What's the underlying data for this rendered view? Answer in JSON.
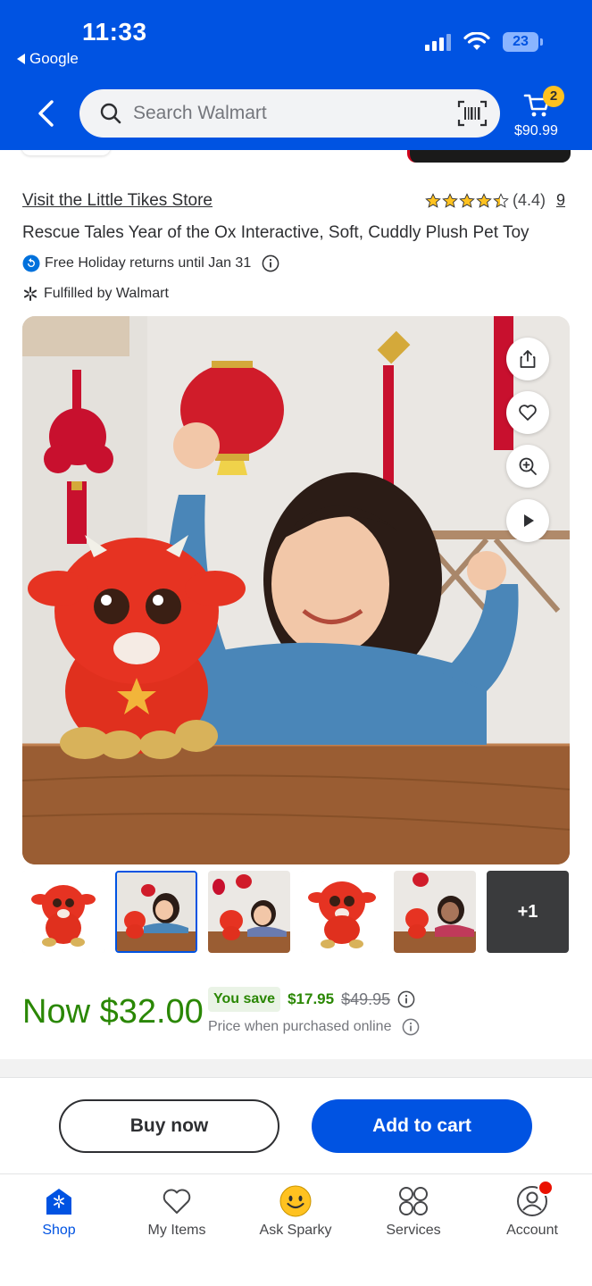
{
  "status_bar": {
    "time": "11:33",
    "back_app": "Google",
    "battery": "23"
  },
  "header": {
    "search": {
      "placeholder": "Search Walmart"
    },
    "cart": {
      "badge": "2",
      "total": "$90.99"
    }
  },
  "product": {
    "store_link": "Visit the Little Tikes Store",
    "rating": {
      "stars": 4.4,
      "value_text": "(4.4)",
      "count": "9"
    },
    "title": "Rescue Tales Year of the Ox Interactive, Soft, Cuddly Plush Pet Toy",
    "returns": "Free Holiday returns until Jan 31",
    "fulfilled": "Fulfilled by Walmart",
    "image_actions": [
      "share-icon",
      "heart-icon",
      "zoom-icon",
      "play-icon"
    ],
    "thumbnails": {
      "count": 6,
      "selected_index": 1,
      "more_label": "+1"
    }
  },
  "price": {
    "now": "Now $32.00",
    "you_save_label": "You save",
    "save_amount": "$17.95",
    "was": "$49.95",
    "note": "Price when purchased online"
  },
  "actions": {
    "buy_now": "Buy now",
    "add_to_cart": "Add to cart"
  },
  "bottom_nav": [
    {
      "label": "Shop",
      "icon": "spark-icon",
      "active": true
    },
    {
      "label": "My Items",
      "icon": "heart-icon",
      "active": false
    },
    {
      "label": "Ask Sparky",
      "icon": "sparky-icon",
      "active": false
    },
    {
      "label": "Services",
      "icon": "grid-icon",
      "active": false
    },
    {
      "label": "Account",
      "icon": "account-icon",
      "active": false
    }
  ],
  "colors": {
    "brand_blue": "#0053e2",
    "price_green": "#2a8703",
    "badge_yellow": "#ffc220",
    "alert_red": "#ea1100"
  }
}
